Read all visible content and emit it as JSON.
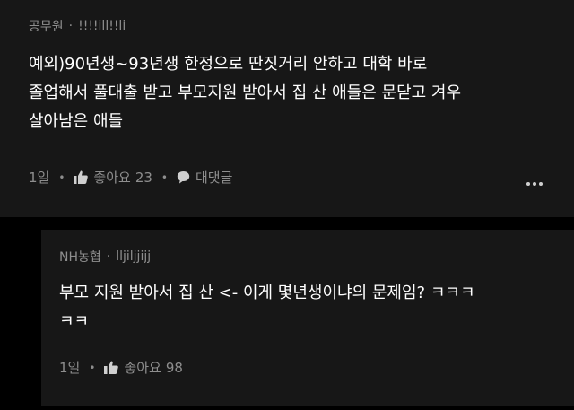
{
  "comment": {
    "author": "공무원",
    "separator": "·",
    "handle": "!!!!ill!!li",
    "lines": [
      "예외)90년생~93년생 한정으로 딴짓거리 안하고 대학 바로",
      "졸업해서 풀대출 받고 부모지원 받아서 집 산 애들은 문닫고 겨우",
      "살아남은 애들"
    ],
    "time": "1일",
    "like_label": "좋아요",
    "like_count": "23",
    "reply_label": "대댓글",
    "icons": {
      "like": "thumbs-up-icon",
      "reply": "speech-bubble-icon",
      "more": "more-dots-icon"
    }
  },
  "reply": {
    "author": "NH농협",
    "separator": "·",
    "handle": "lljiljjijj",
    "lines": [
      "부모 지원 받아서 집 산 <- 이게 몇년생이냐의 문제임? ㅋㅋㅋ",
      "ㅋㅋ"
    ],
    "time": "1일",
    "like_label": "좋아요",
    "like_count": "98",
    "icons": {
      "like": "thumbs-up-icon"
    }
  },
  "colors": {
    "background": "#000000",
    "card": "#171717",
    "text": "#ffffff",
    "muted": "#8e8e8e"
  }
}
